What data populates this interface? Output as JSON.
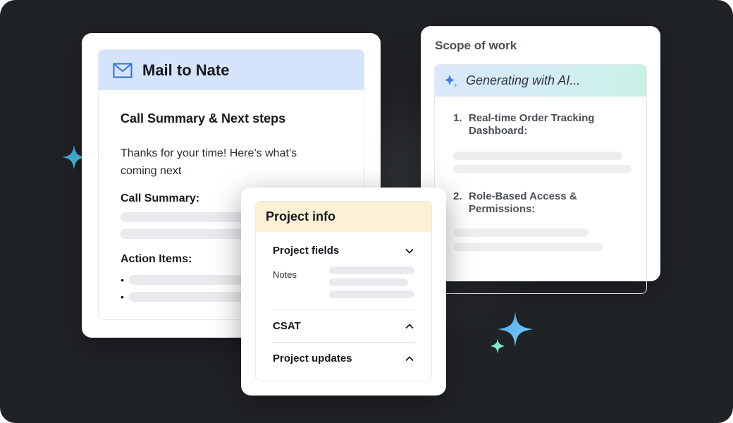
{
  "mail": {
    "title": "Mail to Nate",
    "subject": "Call Summary & Next steps",
    "greeting": "Thanks for your time! Here’s what’s coming next",
    "call_summary_label": "Call Summary:",
    "action_items_label": "Action Items:",
    "bullets": [
      "•",
      "•"
    ]
  },
  "scope": {
    "title": "Scope of work",
    "ai_status": "Generating with AI...",
    "items": [
      {
        "number": "1.",
        "text": "Real-time Order Tracking Dashboard:"
      },
      {
        "number": "2.",
        "text": "Role-Based Access & Permissions:"
      }
    ]
  },
  "project": {
    "title": "Project info",
    "sections": [
      {
        "label": "Project fields",
        "chevron": "chevron-down-icon"
      },
      {
        "label": "CSAT",
        "chevron": "chevron-up-icon"
      },
      {
        "label": "Project updates",
        "chevron": "chevron-up-icon"
      }
    ],
    "notes_label": "Notes"
  },
  "colors": {
    "background": "#202326",
    "mail_header": "#d6e4fb",
    "project_header": "#fcf0d5",
    "accent_blue": "#2f6fd6",
    "sparkle_blue": "#4aa8f0",
    "sparkle_teal": "#5be3c8"
  }
}
